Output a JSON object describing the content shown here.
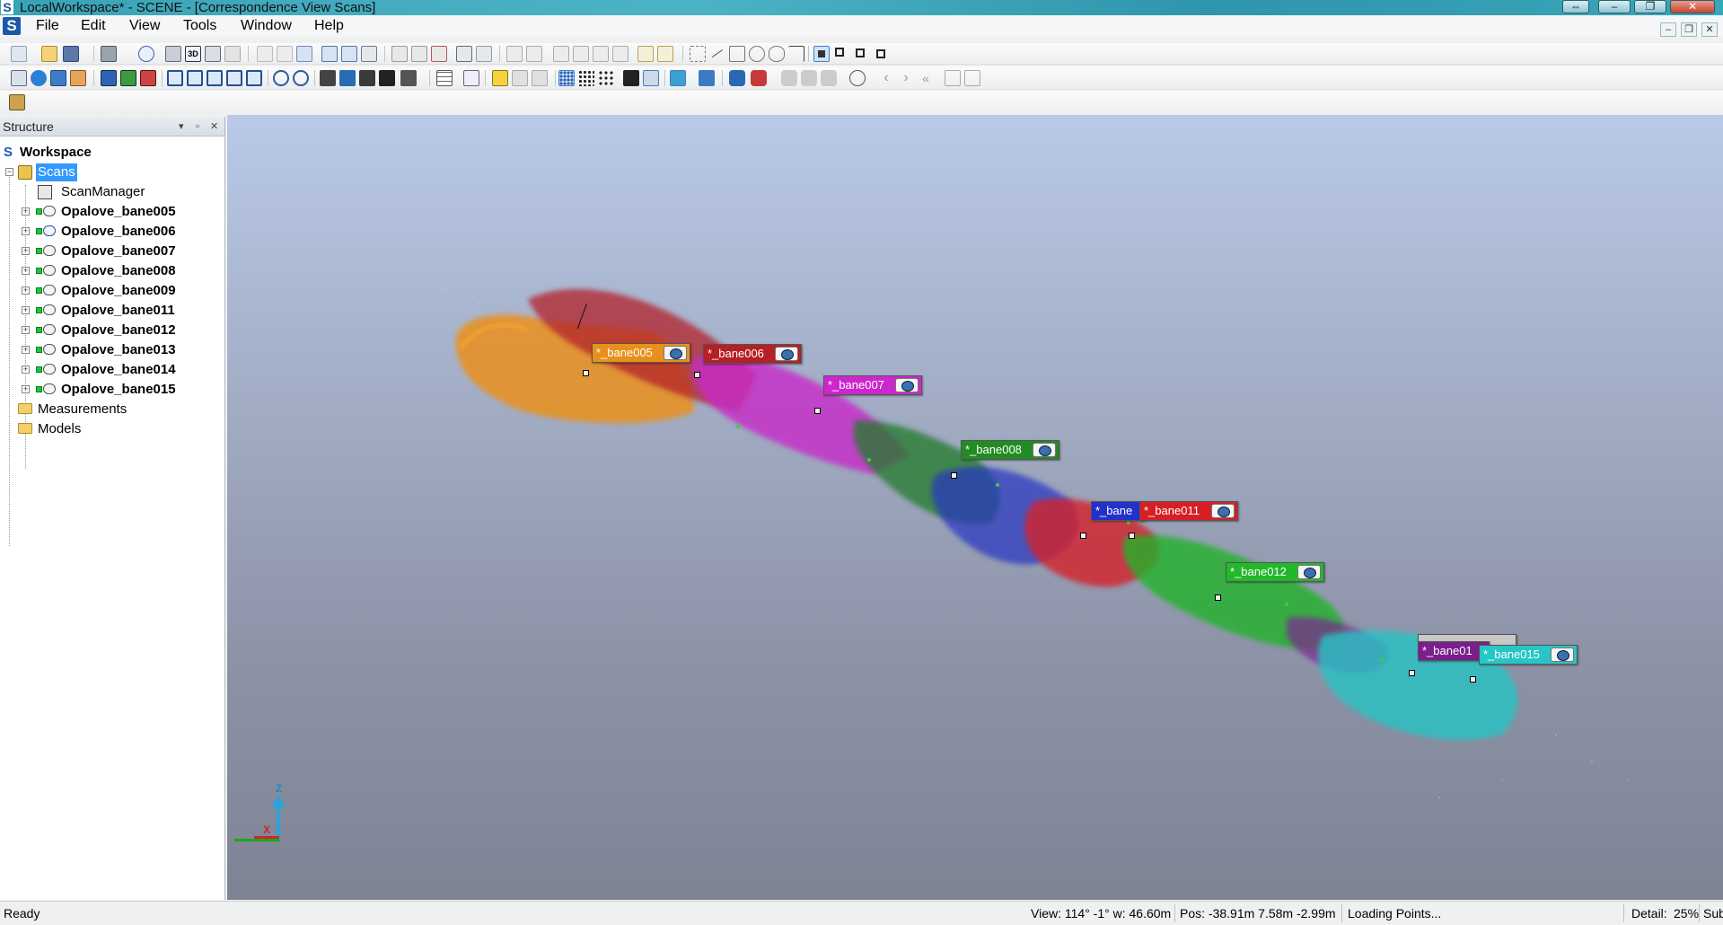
{
  "window": {
    "title": "LocalWorkspace* - SCENE - [Correspondence View Scans]",
    "buttons": [
      "⇔",
      "–",
      "❐",
      "✕"
    ]
  },
  "menubar": {
    "items": [
      "File",
      "Edit",
      "View",
      "Tools",
      "Window",
      "Help"
    ],
    "mdi_buttons": [
      "–",
      "❐",
      "✕"
    ]
  },
  "structure_panel": {
    "title": "Structure",
    "controls": [
      "▾",
      "▫",
      "✕"
    ],
    "workspace": "Workspace",
    "scans_folder": "Scans",
    "scan_manager": "ScanManager",
    "scans": [
      "Opalove_bane005",
      "Opalove_bane006",
      "Opalove_bane007",
      "Opalove_bane008",
      "Opalove_bane009",
      "Opalove_bane011",
      "Opalove_bane012",
      "Opalove_bane013",
      "Opalove_bane014",
      "Opalove_bane015"
    ],
    "measurements": "Measurements",
    "models": "Models"
  },
  "viewport": {
    "scan_tags": [
      {
        "label": "*_bane005",
        "color": "#e8901c"
      },
      {
        "label": "*_bane006",
        "color": "#b51f26"
      },
      {
        "label": "*_bane007",
        "color": "#cc27cc"
      },
      {
        "label": "*_bane008",
        "color": "#228b22"
      },
      {
        "label": "*_bane",
        "color": "#2431c9"
      },
      {
        "label": "*_bane011",
        "color": "#d61f24"
      },
      {
        "label": "*_bane012",
        "color": "#21b92a"
      },
      {
        "label": "*_bane01",
        "color": "#7a1f8c"
      },
      {
        "label": "*_bane015",
        "color": "#27c6c6"
      }
    ],
    "axis_labels": {
      "z": "Z",
      "x": "X"
    }
  },
  "statusbar": {
    "status": "Ready",
    "view": "View: 114° -1° w: 46.60m",
    "pos": "Pos: -38.91m 7.58m -2.99m",
    "loading": "Loading Points...",
    "detail_label": "Detail:",
    "detail_value": "25%",
    "sub": "Sub"
  },
  "colors": {
    "orange_scan": "#e8901c",
    "darkred_scan": "#b51f26",
    "magenta_scan": "#cc27cc",
    "green_scan": "#228b22",
    "blue_scan": "#2431c9",
    "red_scan": "#d61f24",
    "lightgreen_scan": "#21b92a",
    "purple_scan": "#7a1f8c",
    "cyan_scan": "#27c6c6"
  }
}
